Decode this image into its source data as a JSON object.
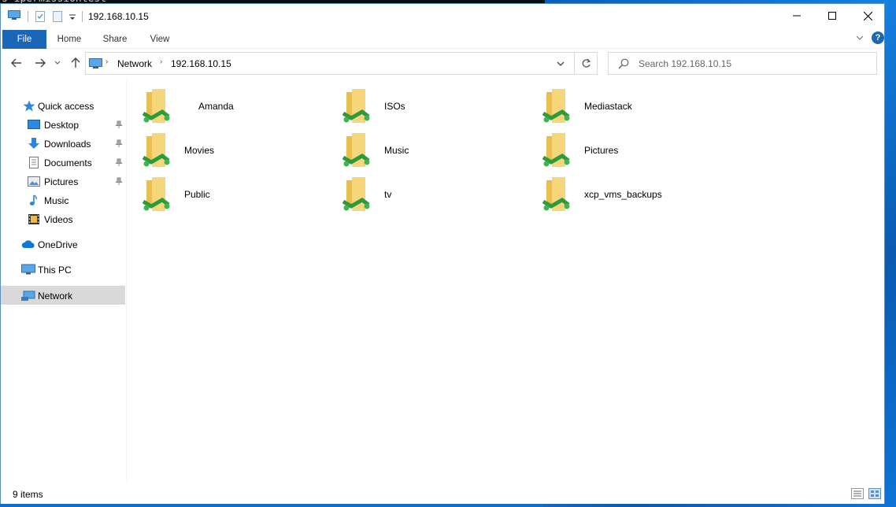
{
  "terminal_text": "s-ipermissiontest",
  "window": {
    "title": "192.168.10.15"
  },
  "ribbon": {
    "tabs": [
      "File",
      "Home",
      "Share",
      "View"
    ],
    "help": "?"
  },
  "address_bar": {
    "crumbs": [
      "Network",
      "192.168.10.15"
    ]
  },
  "search": {
    "placeholder": "Search 192.168.10.15"
  },
  "nav_pane": {
    "items": [
      {
        "label": "Quick access",
        "icon": "star-icon"
      },
      {
        "label": "Desktop",
        "icon": "desktop-icon",
        "pinned": true
      },
      {
        "label": "Downloads",
        "icon": "download-icon",
        "pinned": true
      },
      {
        "label": "Documents",
        "icon": "documents-icon",
        "pinned": true
      },
      {
        "label": "Pictures",
        "icon": "pictures-icon",
        "pinned": true
      },
      {
        "label": "Music",
        "icon": "music-icon"
      },
      {
        "label": "Videos",
        "icon": "videos-icon"
      },
      {
        "label": "OneDrive",
        "icon": "cloud-icon"
      },
      {
        "label": "This PC",
        "icon": "computer-icon"
      },
      {
        "label": "Network",
        "icon": "network-icon",
        "selected": true
      }
    ]
  },
  "shares": [
    "Amanda",
    "ISOs",
    "Mediastack",
    "Movies",
    "Music",
    "Pictures",
    "Public",
    "tv",
    "xcp_vms_backups"
  ],
  "status": {
    "item_count": "9 items"
  },
  "colors": {
    "accent": "#1a66b7",
    "selected": "#d9d9d9",
    "folder": "#f5d67a",
    "share_green": "#3fb34f"
  }
}
